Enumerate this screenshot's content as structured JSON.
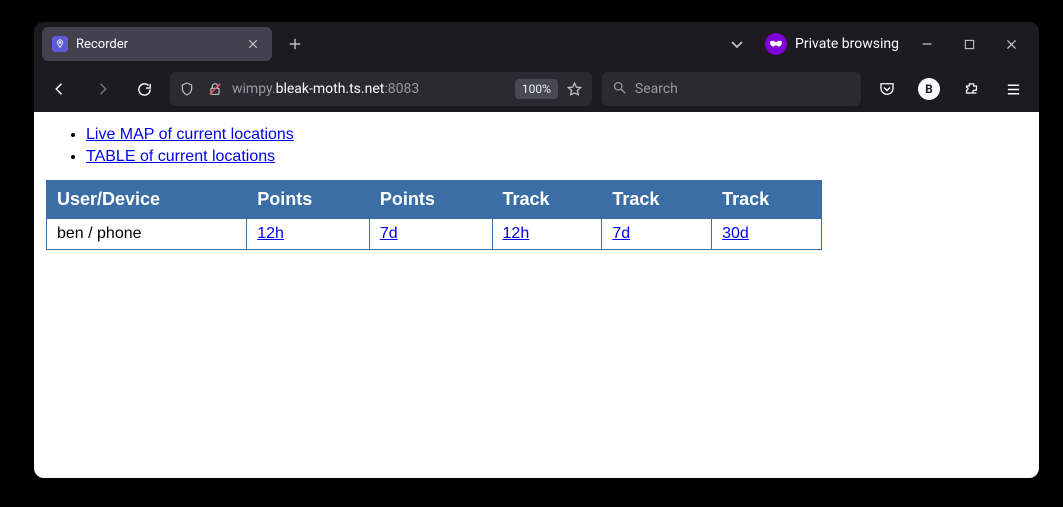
{
  "browser": {
    "tab_title": "Recorder",
    "private_label": "Private browsing",
    "url": {
      "prefix": "wimpy.",
      "host": "bleak-moth.ts.net",
      "suffix": ":8083"
    },
    "zoom": "100%",
    "search_placeholder": "Search",
    "badge": "B"
  },
  "page": {
    "links": [
      "Live MAP of current locations",
      "TABLE of current locations"
    ],
    "table": {
      "headers": [
        "User/Device",
        "Points",
        "Points",
        "Track",
        "Track",
        "Track"
      ],
      "rows": [
        {
          "label": "ben / phone",
          "cells": [
            "12h",
            "7d",
            "12h",
            "7d",
            "30d"
          ]
        }
      ]
    }
  }
}
